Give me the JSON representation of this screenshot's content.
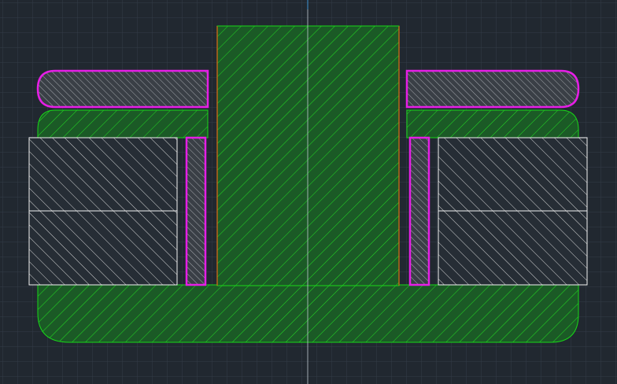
{
  "drawing": {
    "background": "#212830",
    "grid_color": "#343c47",
    "grid_major_color": "#3d4653",
    "colors": {
      "green": "#18d818",
      "green_fill": "#1b5a26",
      "magenta": "#e61ee6",
      "white": "#f2f2f2",
      "orange": "#d06a18",
      "centerline": "#3a82b8"
    },
    "parts": [
      {
        "name": "shaft",
        "label": ""
      },
      {
        "name": "base-plate",
        "label": ""
      },
      {
        "name": "left-washer",
        "label": ""
      },
      {
        "name": "right-washer",
        "label": ""
      },
      {
        "name": "left-bushing",
        "label": ""
      },
      {
        "name": "right-bushing",
        "label": ""
      },
      {
        "name": "left-block",
        "label": ""
      },
      {
        "name": "right-block",
        "label": ""
      }
    ]
  }
}
